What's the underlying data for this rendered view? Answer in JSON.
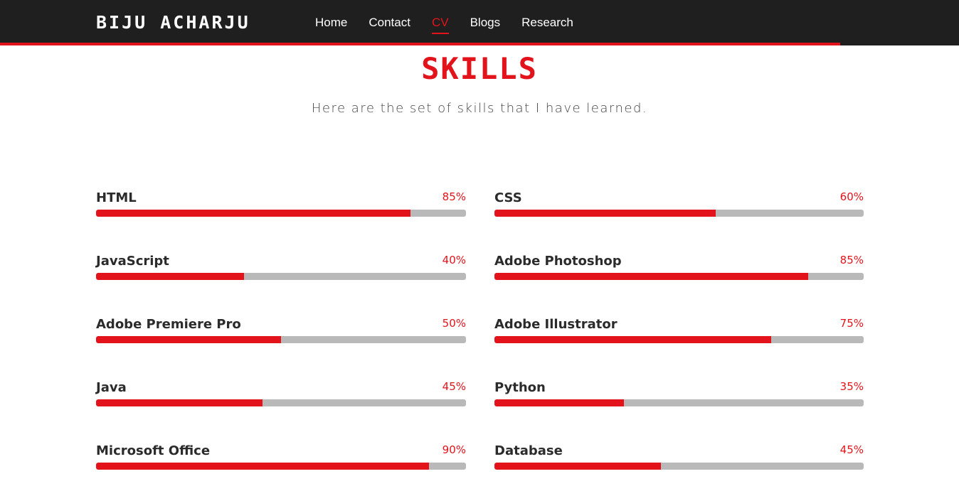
{
  "nav": {
    "brand": "BIJU ACHARJU",
    "links": [
      {
        "label": "Home",
        "active": false
      },
      {
        "label": "Contact",
        "active": false
      },
      {
        "label": "CV",
        "active": true
      },
      {
        "label": "Blogs",
        "active": false
      },
      {
        "label": "Research",
        "active": false
      }
    ]
  },
  "section": {
    "title": "SKILLS",
    "subtitle": "Here are the set of skills that I have learned."
  },
  "colors": {
    "accent": "#e3131b",
    "navbar_bg": "#1f1f1f",
    "bar_track": "#b9b9b9",
    "text_dark": "#2b2b2b"
  },
  "skills": [
    {
      "name": "HTML",
      "percent_label": "85%",
      "value": 85
    },
    {
      "name": "CSS",
      "percent_label": "60%",
      "value": 60
    },
    {
      "name": "JavaScript",
      "percent_label": "40%",
      "value": 40
    },
    {
      "name": "Adobe Photoshop",
      "percent_label": "85%",
      "value": 85
    },
    {
      "name": "Adobe Premiere Pro",
      "percent_label": "50%",
      "value": 50
    },
    {
      "name": "Adobe Illustrator",
      "percent_label": "75%",
      "value": 75
    },
    {
      "name": "Java",
      "percent_label": "45%",
      "value": 45
    },
    {
      "name": "Python",
      "percent_label": "35%",
      "value": 35
    },
    {
      "name": "Microsoft Office",
      "percent_label": "90%",
      "value": 90
    },
    {
      "name": "Database",
      "percent_label": "45%",
      "value": 45
    }
  ]
}
